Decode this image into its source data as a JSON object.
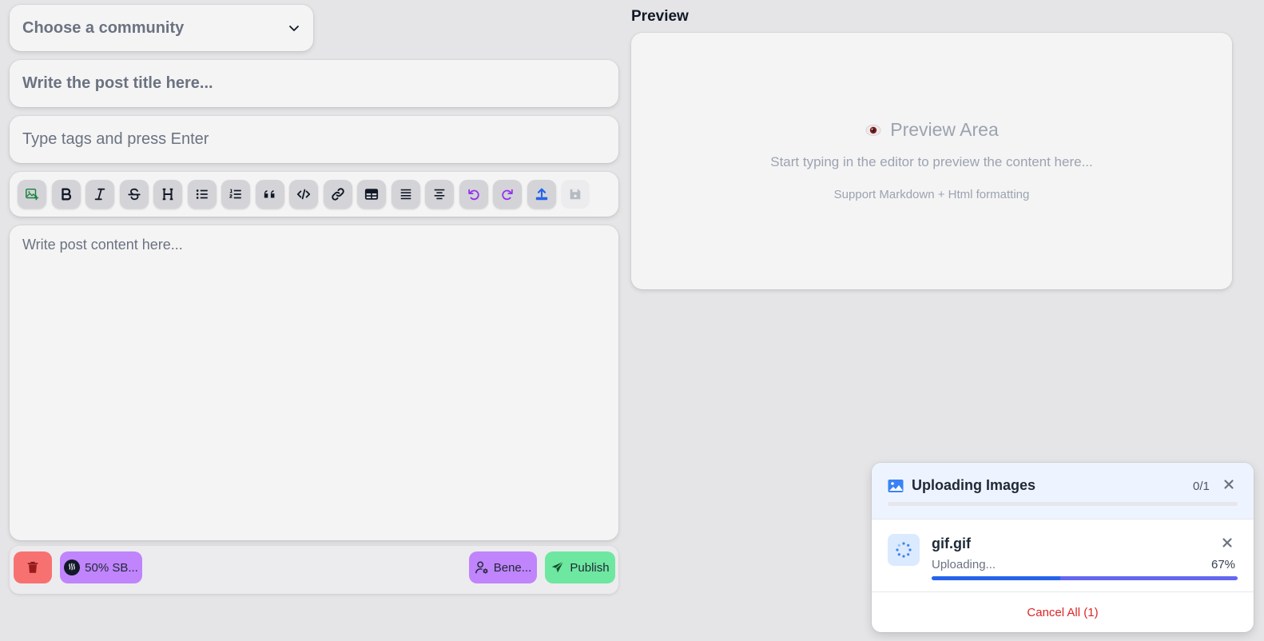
{
  "editor": {
    "community_label": "Choose a community",
    "title_placeholder": "Write the post title here...",
    "tags_placeholder": "Type tags and press Enter",
    "content_placeholder": "Write post content here...",
    "toolbar": [
      {
        "icon": "add-image-icon",
        "color": "#15803d"
      },
      {
        "icon": "bold-icon",
        "color": "#111827"
      },
      {
        "icon": "italic-icon",
        "color": "#111827"
      },
      {
        "icon": "strikethrough-icon",
        "color": "#111827"
      },
      {
        "icon": "heading-icon",
        "color": "#111827"
      },
      {
        "icon": "bullet-list-icon",
        "color": "#111827"
      },
      {
        "icon": "numbered-list-icon",
        "color": "#111827"
      },
      {
        "icon": "quote-icon",
        "color": "#111827"
      },
      {
        "icon": "code-icon",
        "color": "#111827"
      },
      {
        "icon": "link-icon",
        "color": "#111827"
      },
      {
        "icon": "table-icon",
        "color": "#111827"
      },
      {
        "icon": "justify-icon",
        "color": "#111827"
      },
      {
        "icon": "align-center-icon",
        "color": "#111827"
      },
      {
        "icon": "undo-icon",
        "color": "#9333ea"
      },
      {
        "icon": "redo-icon",
        "color": "#9333ea"
      },
      {
        "icon": "upload-icon",
        "color": "#2563eb"
      },
      {
        "icon": "save-icon",
        "color": "#9ca3af",
        "disabled": true
      }
    ],
    "actions": {
      "payout_label": "50% SB...",
      "beneficiaries_label": "Bene...",
      "publish_label": "Publish"
    }
  },
  "preview": {
    "section_title": "Preview",
    "area_title": "Preview Area",
    "subtitle": "Start typing in the editor to preview the content here...",
    "note": "Support Markdown + Html formatting"
  },
  "upload_panel": {
    "title": "Uploading Images",
    "count": "0/1",
    "overall_progress": 0,
    "file": {
      "name": "gif.gif",
      "status": "Uploading...",
      "percent_label": "67%",
      "progress": 100
    },
    "cancel_label": "Cancel All (1)"
  }
}
